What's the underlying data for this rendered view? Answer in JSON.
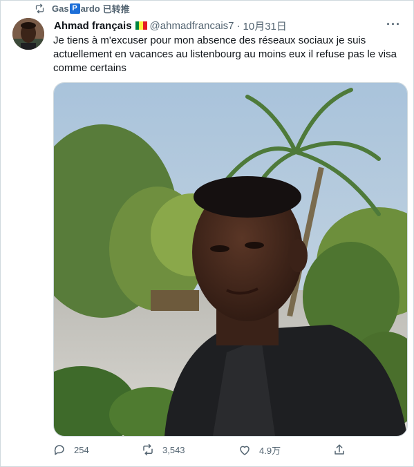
{
  "retweet": {
    "icon": "retweet-icon",
    "name_part1": "Gas",
    "name_badge": "P",
    "name_part2": "ardo",
    "suffix": "已转推"
  },
  "tweet": {
    "author": {
      "display_name": "Ahmad français",
      "flag": "senegal-flag-icon",
      "handle": "@ahmadfrancais7",
      "separator": "·",
      "date": "10月31日"
    },
    "more_icon": "more-icon",
    "text": "Je tiens à m'excuser pour mon absence des réseaux sociaux je suis actuellement en vacances au listenbourg au moins eux il refuse pas le visa comme certains",
    "actions": {
      "reply_count": "254",
      "retweet_count": "3,543",
      "like_count": "4.9万"
    }
  },
  "colors": {
    "text_primary": "#0f1419",
    "text_secondary": "#536471",
    "border": "#cfd9de",
    "badge_blue": "#1d6fd8"
  }
}
